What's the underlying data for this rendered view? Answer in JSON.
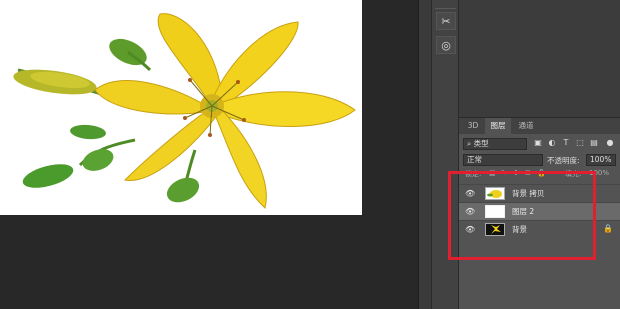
{
  "panel": {
    "tabs": [
      {
        "label": "3D",
        "active": false
      },
      {
        "label": "图层",
        "active": true
      },
      {
        "label": "通道",
        "active": false
      }
    ],
    "filter": {
      "kind_label": "类型"
    },
    "blend": {
      "mode": "正常",
      "opacity_label": "不透明度:",
      "opacity_value": "100%"
    },
    "lock": {
      "label": "锁定:",
      "fill_label": "填充:",
      "fill_value": "100%"
    },
    "layers": [
      {
        "name": "背景 拷贝",
        "visible": true,
        "selected": false,
        "locked": false
      },
      {
        "name": "图层 2",
        "visible": true,
        "selected": true,
        "locked": false
      },
      {
        "name": "背景",
        "visible": true,
        "selected": false,
        "locked": true
      }
    ]
  },
  "colors": {
    "highlight": "#e02030",
    "panel": "#535353",
    "petal": "#f2d21c"
  }
}
